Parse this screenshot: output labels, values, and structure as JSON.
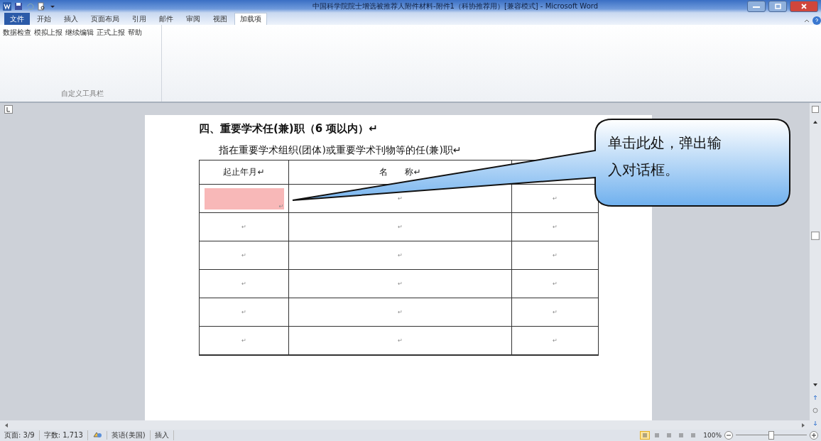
{
  "window": {
    "title": "中国科学院院士增选被推荐人附件材料-附件1（科协推荐用）[兼容模式] - Microsoft Word"
  },
  "tabs": [
    {
      "label": "文件",
      "kind": "file",
      "selected": false
    },
    {
      "label": "开始",
      "kind": "tab",
      "selected": false
    },
    {
      "label": "插入",
      "kind": "tab",
      "selected": false
    },
    {
      "label": "页面布局",
      "kind": "tab",
      "selected": false
    },
    {
      "label": "引用",
      "kind": "tab",
      "selected": false
    },
    {
      "label": "邮件",
      "kind": "tab",
      "selected": false
    },
    {
      "label": "审阅",
      "kind": "tab",
      "selected": false
    },
    {
      "label": "视图",
      "kind": "tab",
      "selected": false
    },
    {
      "label": "加载项",
      "kind": "tab",
      "selected": true
    }
  ],
  "ribbon": {
    "buttons": [
      "数据检查",
      "模拟上报",
      "继续编辑",
      "正式上报",
      "帮助"
    ],
    "group_label": "自定义工具栏"
  },
  "document": {
    "heading": "四、重要学术任(兼)职（6 项以内）↵",
    "subheading": "指在重要学术组织(团体)或重要学术刊物等的任(兼)职↵",
    "table": {
      "columns": [
        "起止年月↵",
        "名　　称↵"
      ],
      "rows": [
        {
          "cells": [
            "↵",
            "↵",
            "↵"
          ],
          "highlighted": true
        },
        {
          "cells": [
            "↵",
            "↵",
            "↵"
          ],
          "highlighted": false
        },
        {
          "cells": [
            "↵",
            "↵",
            "↵"
          ],
          "highlighted": false
        },
        {
          "cells": [
            "↵",
            "↵",
            "↵"
          ],
          "highlighted": false
        },
        {
          "cells": [
            "↵",
            "↵",
            "↵"
          ],
          "highlighted": false
        },
        {
          "cells": [
            "↵",
            "↵",
            "↵"
          ],
          "highlighted": false
        }
      ]
    }
  },
  "callout": {
    "text": "单击此处，弹出输入对话框。"
  },
  "status_bar": {
    "items": [
      "页面: 3/9",
      "字数: 1,713"
    ],
    "language": "英语(美国)",
    "mode": "插入",
    "views": [
      {
        "selected": true
      },
      {
        "selected": false
      },
      {
        "selected": false
      },
      {
        "selected": false
      },
      {
        "selected": false
      }
    ],
    "zoom": "100%",
    "zoom_slider": {
      "level": 0.5
    }
  }
}
